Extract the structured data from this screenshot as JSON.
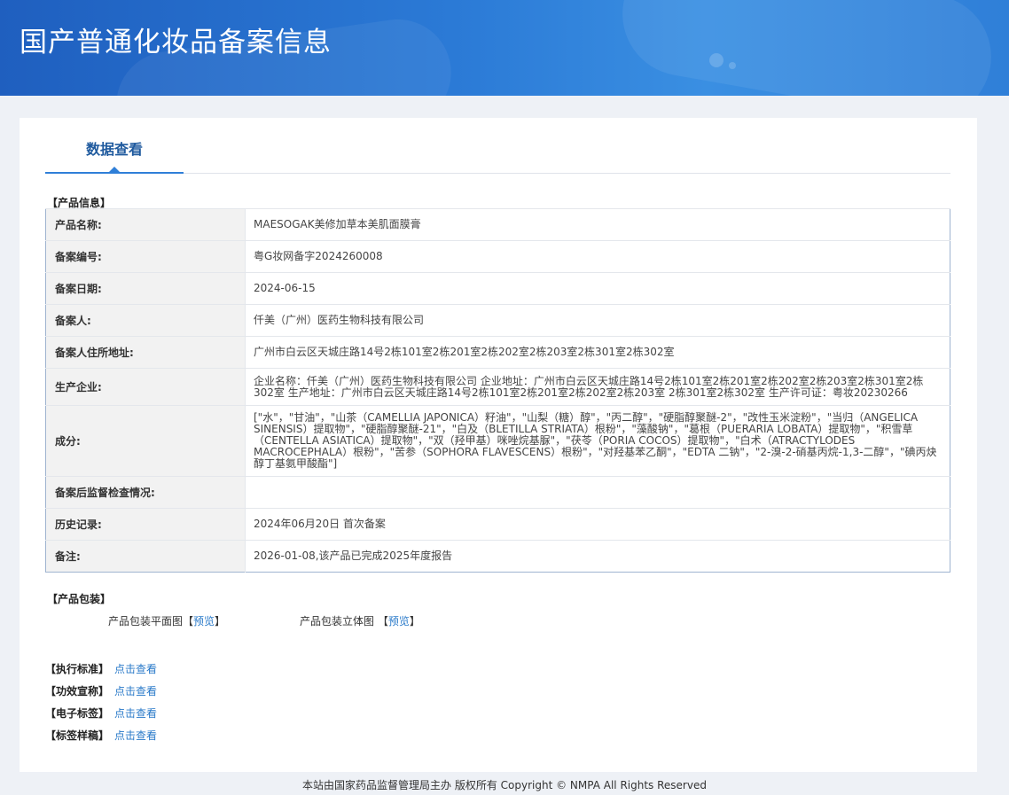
{
  "header": {
    "title": "国产普通化妆品备案信息"
  },
  "tabs": [
    {
      "label": "数据查看"
    }
  ],
  "product_info": {
    "section_title": "【产品信息】",
    "rows": [
      {
        "label": "产品名称:",
        "value": "MAESOGAK美修加草本美肌面膜膏"
      },
      {
        "label": "备案编号:",
        "value": "粤G妆网备字2024260008"
      },
      {
        "label": "备案日期:",
        "value": "2024-06-15"
      },
      {
        "label": "备案人:",
        "value": "仟美（广州）医药生物科技有限公司"
      },
      {
        "label": "备案人住所地址:",
        "value": "广州市白云区天城庄路14号2栋101室2栋201室2栋202室2栋203室2栋301室2栋302室"
      },
      {
        "label": "生产企业:",
        "value": "企业名称：仟美（广州）医药生物科技有限公司 企业地址：广州市白云区天城庄路14号2栋101室2栋201室2栋202室2栋203室2栋301室2栋302室 生产地址：广州市白云区天城庄路14号2栋101室2栋201室2栋202室2栋203室 2栋301室2栋302室 生产许可证：粤妆20230266"
      },
      {
        "label": "成分:",
        "value": "[\"水\"，\"甘油\"，\"山茶（CAMELLIA JAPONICA）籽油\"，\"山梨（糖）醇\"，\"丙二醇\"，\"硬脂醇聚醚-2\"，\"改性玉米淀粉\"，\"当归（ANGELICA SINENSIS）提取物\"，\"硬脂醇聚醚-21\"，\"白及（BLETILLA STRIATA）根粉\"，\"藻酸钠\"，\"葛根（PUERARIA LOBATA）提取物\"，\"积雪草（CENTELLA ASIATICA）提取物\"，\"双（羟甲基）咪唑烷基脲\"，\"茯苓（PORIA COCOS）提取物\"，\"白术（ATRACTYLODES MACROCEPHALA）根粉\"，\"苦参（SOPHORA FLAVESCENS）根粉\"，\"对羟基苯乙酮\"，\"EDTA 二钠\"，\"2-溴-2-硝基丙烷-1,3-二醇\"，\"碘丙炔醇丁基氨甲酸酯\"]"
      },
      {
        "label": "备案后监督检查情况:",
        "value": ""
      },
      {
        "label": "历史记录:",
        "value": "2024年06月20日 首次备案"
      },
      {
        "label": "备注:",
        "value": "2026-01-08,该产品已完成2025年度报告"
      }
    ]
  },
  "packaging": {
    "section_title": "【产品包装】",
    "flat_label": "产品包装平面图【",
    "flat_link": "预览",
    "flat_close": "】",
    "solid_label": "产品包装立体图 【",
    "solid_link": "预览",
    "solid_close": "】"
  },
  "links": [
    {
      "label": "【执行标准】",
      "link": "点击查看"
    },
    {
      "label": "【功效宣称】",
      "link": "点击查看"
    },
    {
      "label": "【电子标签】",
      "link": "点击查看"
    },
    {
      "label": "【标签样稿】",
      "link": "点击查看"
    }
  ],
  "footer": {
    "text": "本站由国家药品监督管理局主办 版权所有 Copyright © NMPA All Rights Reserved"
  }
}
